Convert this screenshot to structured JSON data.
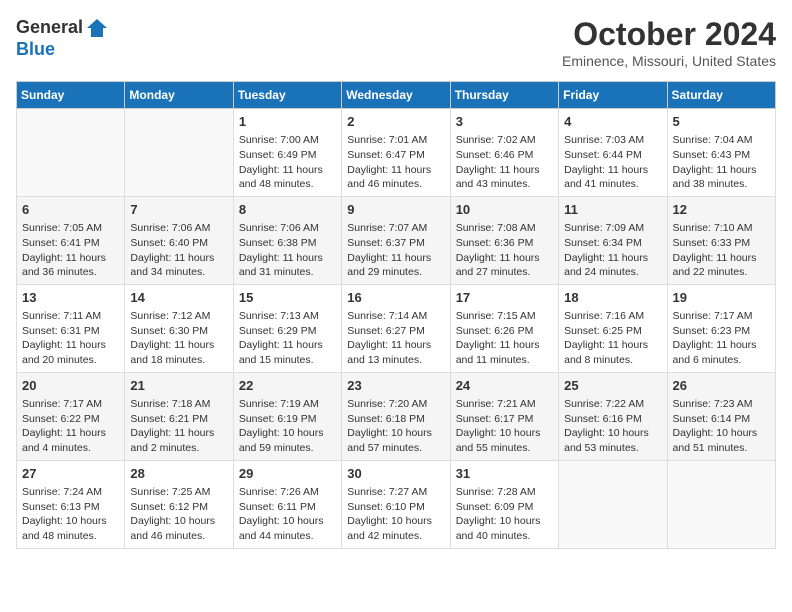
{
  "header": {
    "logo_general": "General",
    "logo_blue": "Blue",
    "month_title": "October 2024",
    "location": "Eminence, Missouri, United States"
  },
  "weekdays": [
    "Sunday",
    "Monday",
    "Tuesday",
    "Wednesday",
    "Thursday",
    "Friday",
    "Saturday"
  ],
  "weeks": [
    [
      {
        "day": "",
        "sunrise": "",
        "sunset": "",
        "daylight": ""
      },
      {
        "day": "",
        "sunrise": "",
        "sunset": "",
        "daylight": ""
      },
      {
        "day": "1",
        "sunrise": "Sunrise: 7:00 AM",
        "sunset": "Sunset: 6:49 PM",
        "daylight": "Daylight: 11 hours and 48 minutes."
      },
      {
        "day": "2",
        "sunrise": "Sunrise: 7:01 AM",
        "sunset": "Sunset: 6:47 PM",
        "daylight": "Daylight: 11 hours and 46 minutes."
      },
      {
        "day": "3",
        "sunrise": "Sunrise: 7:02 AM",
        "sunset": "Sunset: 6:46 PM",
        "daylight": "Daylight: 11 hours and 43 minutes."
      },
      {
        "day": "4",
        "sunrise": "Sunrise: 7:03 AM",
        "sunset": "Sunset: 6:44 PM",
        "daylight": "Daylight: 11 hours and 41 minutes."
      },
      {
        "day": "5",
        "sunrise": "Sunrise: 7:04 AM",
        "sunset": "Sunset: 6:43 PM",
        "daylight": "Daylight: 11 hours and 38 minutes."
      }
    ],
    [
      {
        "day": "6",
        "sunrise": "Sunrise: 7:05 AM",
        "sunset": "Sunset: 6:41 PM",
        "daylight": "Daylight: 11 hours and 36 minutes."
      },
      {
        "day": "7",
        "sunrise": "Sunrise: 7:06 AM",
        "sunset": "Sunset: 6:40 PM",
        "daylight": "Daylight: 11 hours and 34 minutes."
      },
      {
        "day": "8",
        "sunrise": "Sunrise: 7:06 AM",
        "sunset": "Sunset: 6:38 PM",
        "daylight": "Daylight: 11 hours and 31 minutes."
      },
      {
        "day": "9",
        "sunrise": "Sunrise: 7:07 AM",
        "sunset": "Sunset: 6:37 PM",
        "daylight": "Daylight: 11 hours and 29 minutes."
      },
      {
        "day": "10",
        "sunrise": "Sunrise: 7:08 AM",
        "sunset": "Sunset: 6:36 PM",
        "daylight": "Daylight: 11 hours and 27 minutes."
      },
      {
        "day": "11",
        "sunrise": "Sunrise: 7:09 AM",
        "sunset": "Sunset: 6:34 PM",
        "daylight": "Daylight: 11 hours and 24 minutes."
      },
      {
        "day": "12",
        "sunrise": "Sunrise: 7:10 AM",
        "sunset": "Sunset: 6:33 PM",
        "daylight": "Daylight: 11 hours and 22 minutes."
      }
    ],
    [
      {
        "day": "13",
        "sunrise": "Sunrise: 7:11 AM",
        "sunset": "Sunset: 6:31 PM",
        "daylight": "Daylight: 11 hours and 20 minutes."
      },
      {
        "day": "14",
        "sunrise": "Sunrise: 7:12 AM",
        "sunset": "Sunset: 6:30 PM",
        "daylight": "Daylight: 11 hours and 18 minutes."
      },
      {
        "day": "15",
        "sunrise": "Sunrise: 7:13 AM",
        "sunset": "Sunset: 6:29 PM",
        "daylight": "Daylight: 11 hours and 15 minutes."
      },
      {
        "day": "16",
        "sunrise": "Sunrise: 7:14 AM",
        "sunset": "Sunset: 6:27 PM",
        "daylight": "Daylight: 11 hours and 13 minutes."
      },
      {
        "day": "17",
        "sunrise": "Sunrise: 7:15 AM",
        "sunset": "Sunset: 6:26 PM",
        "daylight": "Daylight: 11 hours and 11 minutes."
      },
      {
        "day": "18",
        "sunrise": "Sunrise: 7:16 AM",
        "sunset": "Sunset: 6:25 PM",
        "daylight": "Daylight: 11 hours and 8 minutes."
      },
      {
        "day": "19",
        "sunrise": "Sunrise: 7:17 AM",
        "sunset": "Sunset: 6:23 PM",
        "daylight": "Daylight: 11 hours and 6 minutes."
      }
    ],
    [
      {
        "day": "20",
        "sunrise": "Sunrise: 7:17 AM",
        "sunset": "Sunset: 6:22 PM",
        "daylight": "Daylight: 11 hours and 4 minutes."
      },
      {
        "day": "21",
        "sunrise": "Sunrise: 7:18 AM",
        "sunset": "Sunset: 6:21 PM",
        "daylight": "Daylight: 11 hours and 2 minutes."
      },
      {
        "day": "22",
        "sunrise": "Sunrise: 7:19 AM",
        "sunset": "Sunset: 6:19 PM",
        "daylight": "Daylight: 10 hours and 59 minutes."
      },
      {
        "day": "23",
        "sunrise": "Sunrise: 7:20 AM",
        "sunset": "Sunset: 6:18 PM",
        "daylight": "Daylight: 10 hours and 57 minutes."
      },
      {
        "day": "24",
        "sunrise": "Sunrise: 7:21 AM",
        "sunset": "Sunset: 6:17 PM",
        "daylight": "Daylight: 10 hours and 55 minutes."
      },
      {
        "day": "25",
        "sunrise": "Sunrise: 7:22 AM",
        "sunset": "Sunset: 6:16 PM",
        "daylight": "Daylight: 10 hours and 53 minutes."
      },
      {
        "day": "26",
        "sunrise": "Sunrise: 7:23 AM",
        "sunset": "Sunset: 6:14 PM",
        "daylight": "Daylight: 10 hours and 51 minutes."
      }
    ],
    [
      {
        "day": "27",
        "sunrise": "Sunrise: 7:24 AM",
        "sunset": "Sunset: 6:13 PM",
        "daylight": "Daylight: 10 hours and 48 minutes."
      },
      {
        "day": "28",
        "sunrise": "Sunrise: 7:25 AM",
        "sunset": "Sunset: 6:12 PM",
        "daylight": "Daylight: 10 hours and 46 minutes."
      },
      {
        "day": "29",
        "sunrise": "Sunrise: 7:26 AM",
        "sunset": "Sunset: 6:11 PM",
        "daylight": "Daylight: 10 hours and 44 minutes."
      },
      {
        "day": "30",
        "sunrise": "Sunrise: 7:27 AM",
        "sunset": "Sunset: 6:10 PM",
        "daylight": "Daylight: 10 hours and 42 minutes."
      },
      {
        "day": "31",
        "sunrise": "Sunrise: 7:28 AM",
        "sunset": "Sunset: 6:09 PM",
        "daylight": "Daylight: 10 hours and 40 minutes."
      },
      {
        "day": "",
        "sunrise": "",
        "sunset": "",
        "daylight": ""
      },
      {
        "day": "",
        "sunrise": "",
        "sunset": "",
        "daylight": ""
      }
    ]
  ]
}
